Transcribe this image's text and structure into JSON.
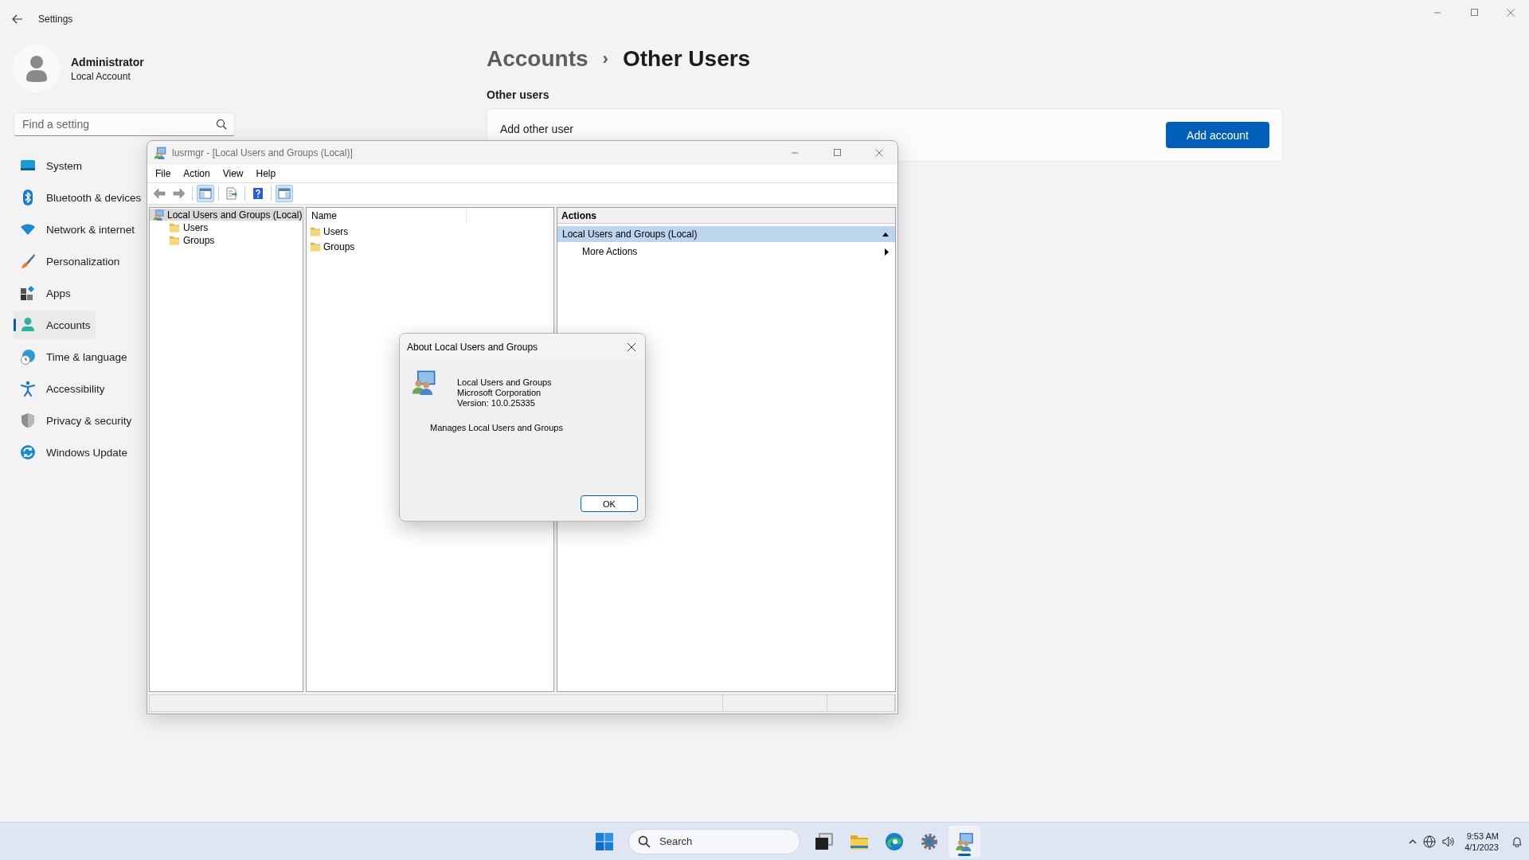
{
  "settings": {
    "title": "Settings",
    "user": {
      "name": "Administrator",
      "account_type": "Local Account"
    },
    "search": {
      "placeholder": "Find a setting"
    },
    "nav": [
      {
        "label": "System",
        "selected": false
      },
      {
        "label": "Bluetooth & devices",
        "selected": false
      },
      {
        "label": "Network & internet",
        "selected": false
      },
      {
        "label": "Personalization",
        "selected": false
      },
      {
        "label": "Apps",
        "selected": false
      },
      {
        "label": "Accounts",
        "selected": true
      },
      {
        "label": "Time & language",
        "selected": false
      },
      {
        "label": "Accessibility",
        "selected": false
      },
      {
        "label": "Privacy & security",
        "selected": false
      },
      {
        "label": "Windows Update",
        "selected": false
      }
    ],
    "breadcrumb": {
      "parent": "Accounts",
      "separator": "›",
      "current": "Other Users"
    },
    "section_title": "Other users",
    "card": {
      "label": "Add other user",
      "button": "Add account"
    }
  },
  "mmc": {
    "title": "lusrmgr - [Local Users and Groups (Local)]",
    "menu": [
      "File",
      "Action",
      "View",
      "Help"
    ],
    "toolbar": [
      {
        "kind": "back",
        "pressed": false
      },
      {
        "kind": "forward",
        "pressed": false
      },
      {
        "kind": "console_tree",
        "pressed": true
      },
      {
        "kind": "export",
        "pressed": false
      },
      {
        "kind": "help",
        "pressed": false
      },
      {
        "kind": "action_pane",
        "pressed": true
      }
    ],
    "tree": [
      {
        "label": "Local Users and Groups (Local)",
        "selected": true,
        "children": [
          {
            "label": "Users",
            "selected": false
          },
          {
            "label": "Groups",
            "selected": false
          }
        ]
      }
    ],
    "list": {
      "columns": [
        "Name"
      ],
      "items": [
        "Users",
        "Groups"
      ]
    },
    "actions": {
      "title": "Actions",
      "sections": [
        {
          "label": "Local Users and Groups (Local)",
          "expanded": true,
          "items": [
            {
              "label": "More Actions",
              "submenu": true
            }
          ]
        }
      ]
    }
  },
  "dialog": {
    "title": "About Local Users and Groups",
    "product": "Local Users and Groups",
    "company": "Microsoft Corporation",
    "version": "Version: 10.0.25335",
    "description": "Manages Local Users and Groups",
    "button": "OK"
  },
  "taskbar": {
    "search": {
      "placeholder": "Search"
    },
    "apps": [
      {
        "kind": "task_view",
        "active": false
      },
      {
        "kind": "file_explorer",
        "active": false
      },
      {
        "kind": "browser",
        "active": false
      },
      {
        "kind": "settings",
        "active": false
      },
      {
        "kind": "lusrmgr",
        "active": true
      }
    ],
    "time": "9:53 AM",
    "date": "4/1/2023"
  }
}
